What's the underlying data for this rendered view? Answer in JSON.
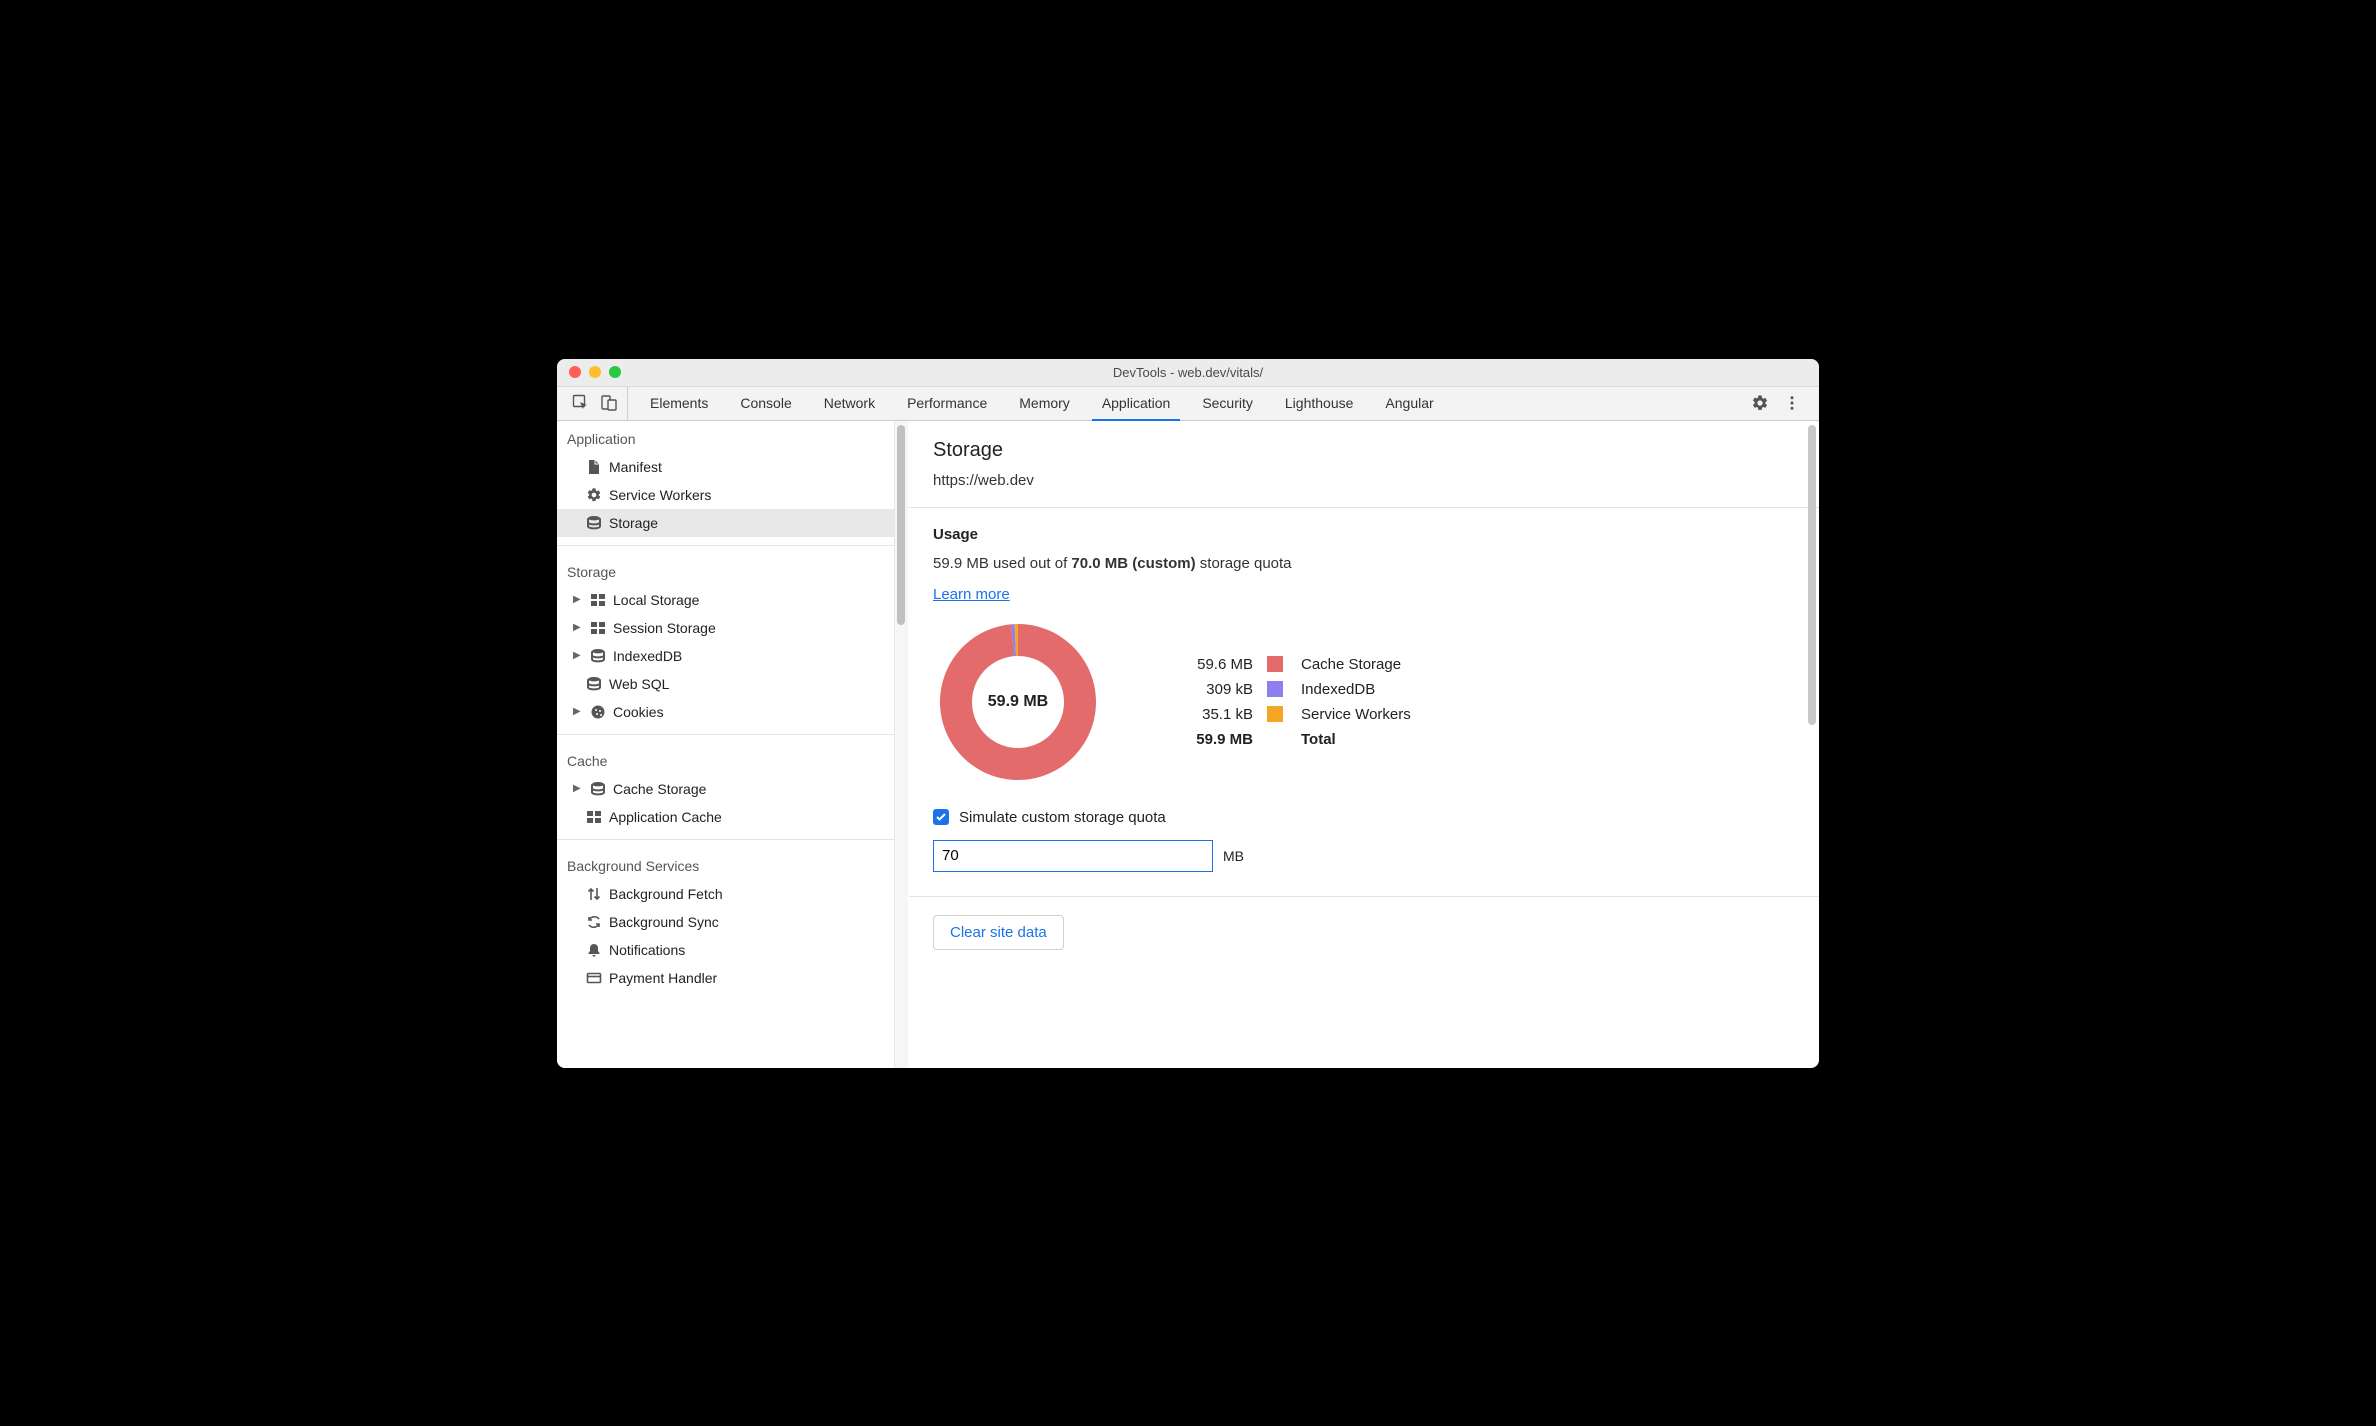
{
  "window": {
    "title": "DevTools - web.dev/vitals/"
  },
  "tabstrip": {
    "tabs": [
      "Elements",
      "Console",
      "Network",
      "Performance",
      "Memory",
      "Application",
      "Security",
      "Lighthouse",
      "Angular"
    ],
    "active_tab": "Application"
  },
  "sidebar": {
    "sections": [
      {
        "title": "Application",
        "items": [
          {
            "label": "Manifest",
            "icon": "file-icon"
          },
          {
            "label": "Service Workers",
            "icon": "gear-icon"
          },
          {
            "label": "Storage",
            "icon": "database-icon",
            "selected": true
          }
        ]
      },
      {
        "title": "Storage",
        "items": [
          {
            "label": "Local Storage",
            "icon": "grid-icon",
            "expandable": true
          },
          {
            "label": "Session Storage",
            "icon": "grid-icon",
            "expandable": true
          },
          {
            "label": "IndexedDB",
            "icon": "database-icon",
            "expandable": true
          },
          {
            "label": "Web SQL",
            "icon": "database-icon"
          },
          {
            "label": "Cookies",
            "icon": "cookie-icon",
            "expandable": true
          }
        ]
      },
      {
        "title": "Cache",
        "items": [
          {
            "label": "Cache Storage",
            "icon": "database-icon",
            "expandable": true
          },
          {
            "label": "Application Cache",
            "icon": "grid-icon"
          }
        ]
      },
      {
        "title": "Background Services",
        "items": [
          {
            "label": "Background Fetch",
            "icon": "arrows-updown-icon"
          },
          {
            "label": "Background Sync",
            "icon": "sync-icon"
          },
          {
            "label": "Notifications",
            "icon": "bell-icon"
          },
          {
            "label": "Payment Handler",
            "icon": "card-icon"
          }
        ]
      }
    ]
  },
  "panel": {
    "title": "Storage",
    "origin": "https://web.dev",
    "usage": {
      "heading": "Usage",
      "line_prefix": "59.9 MB used out of ",
      "line_bold": "70.0 MB (custom)",
      "line_suffix": " storage quota",
      "learn_more": "Learn more",
      "total_label": "Total",
      "total_value": "59.9 MB",
      "donut_center": "59.9 MB"
    },
    "simulate": {
      "label": "Simulate custom storage quota",
      "checked": true,
      "input_value": "70",
      "unit": "MB"
    },
    "clear_button": "Clear site data"
  },
  "chart_data": {
    "type": "pie",
    "title": "Storage usage",
    "series": [
      {
        "name": "Cache Storage",
        "display": "59.6 MB",
        "bytes": 59600000,
        "color": "#e36b6b"
      },
      {
        "name": "IndexedDB",
        "display": "309 kB",
        "bytes": 309000,
        "color": "#8d7fef"
      },
      {
        "name": "Service Workers",
        "display": "35.1 kB",
        "bytes": 35100,
        "color": "#f5a623"
      }
    ],
    "total_display": "59.9 MB",
    "total_bytes": 59944100
  }
}
